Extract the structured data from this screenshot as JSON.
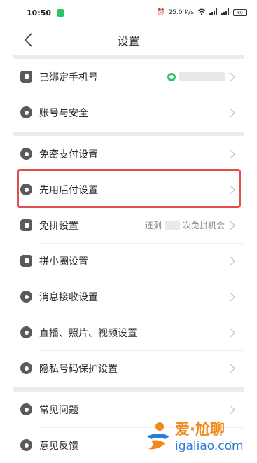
{
  "status_bar": {
    "time": "10:50",
    "network_speed": "25.0 K/s",
    "battery": "69"
  },
  "nav": {
    "title": "设置"
  },
  "section1": [
    {
      "label": "已绑定手机号",
      "icon": "phone-icon",
      "value": ""
    },
    {
      "label": "账号与安全",
      "icon": "shield-icon",
      "value": ""
    }
  ],
  "section2": [
    {
      "label": "免密支付设置",
      "icon": "key-icon",
      "value": ""
    },
    {
      "label": "先用后付设置",
      "icon": "clock-icon",
      "value": ""
    },
    {
      "label": "免拼设置",
      "icon": "group-buy-icon",
      "value_prefix": "还剩",
      "value_suffix": "次免拼机会"
    },
    {
      "label": "拼小圈设置",
      "icon": "bag-icon",
      "value": ""
    },
    {
      "label": "消息接收设置",
      "icon": "message-icon",
      "value": ""
    },
    {
      "label": "直播、照片、视频设置",
      "icon": "camera-icon",
      "value": ""
    },
    {
      "label": "隐私号码保护设置",
      "icon": "privacy-icon",
      "value": ""
    }
  ],
  "section3": [
    {
      "label": "常见问题",
      "icon": "question-icon",
      "value": ""
    },
    {
      "label": "意见反馈",
      "icon": "feedback-icon",
      "value": ""
    }
  ],
  "watermark": {
    "title": "爱·尬聊",
    "url": "igaliao.com"
  },
  "colors": {
    "highlight": "#e24d4d",
    "wechat_green": "#2cc36b",
    "watermark_orange": "#f08a1e",
    "watermark_blue": "#2d7bd8"
  }
}
